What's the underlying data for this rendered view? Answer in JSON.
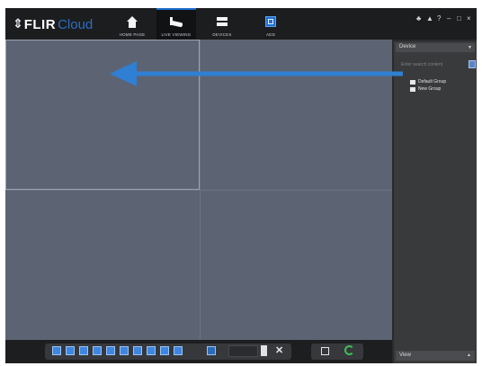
{
  "app": {
    "logo_symbol": "⇕",
    "logo_brand": "FLIR",
    "logo_product": "Cloud"
  },
  "nav": [
    {
      "label": "HOME PAGE",
      "icon": "home-icon",
      "active": false
    },
    {
      "label": "LIVE VIEWING",
      "icon": "camera-icon",
      "active": true
    },
    {
      "label": "DEVICES",
      "icon": "devices-icon",
      "active": false
    },
    {
      "label": "ADD",
      "icon": "add-icon",
      "active": false
    }
  ],
  "window_controls": {
    "user": "♣",
    "lock": "▲",
    "help": "?",
    "minimize": "–",
    "maximize": "□",
    "close": "×"
  },
  "right_panel": {
    "header": "Device",
    "header_caret": "▼",
    "search_placeholder": "Enter search content",
    "items": [
      {
        "label": "Default Group"
      },
      {
        "label": "New Group"
      }
    ],
    "footer": "View",
    "footer_caret": "▲"
  },
  "toolbar": {
    "close_label": "✕"
  },
  "colors": {
    "accent": "#1f6fd0",
    "arrow": "#2f7fd3",
    "tile": "#5c6473",
    "refresh": "#3fbf55"
  }
}
